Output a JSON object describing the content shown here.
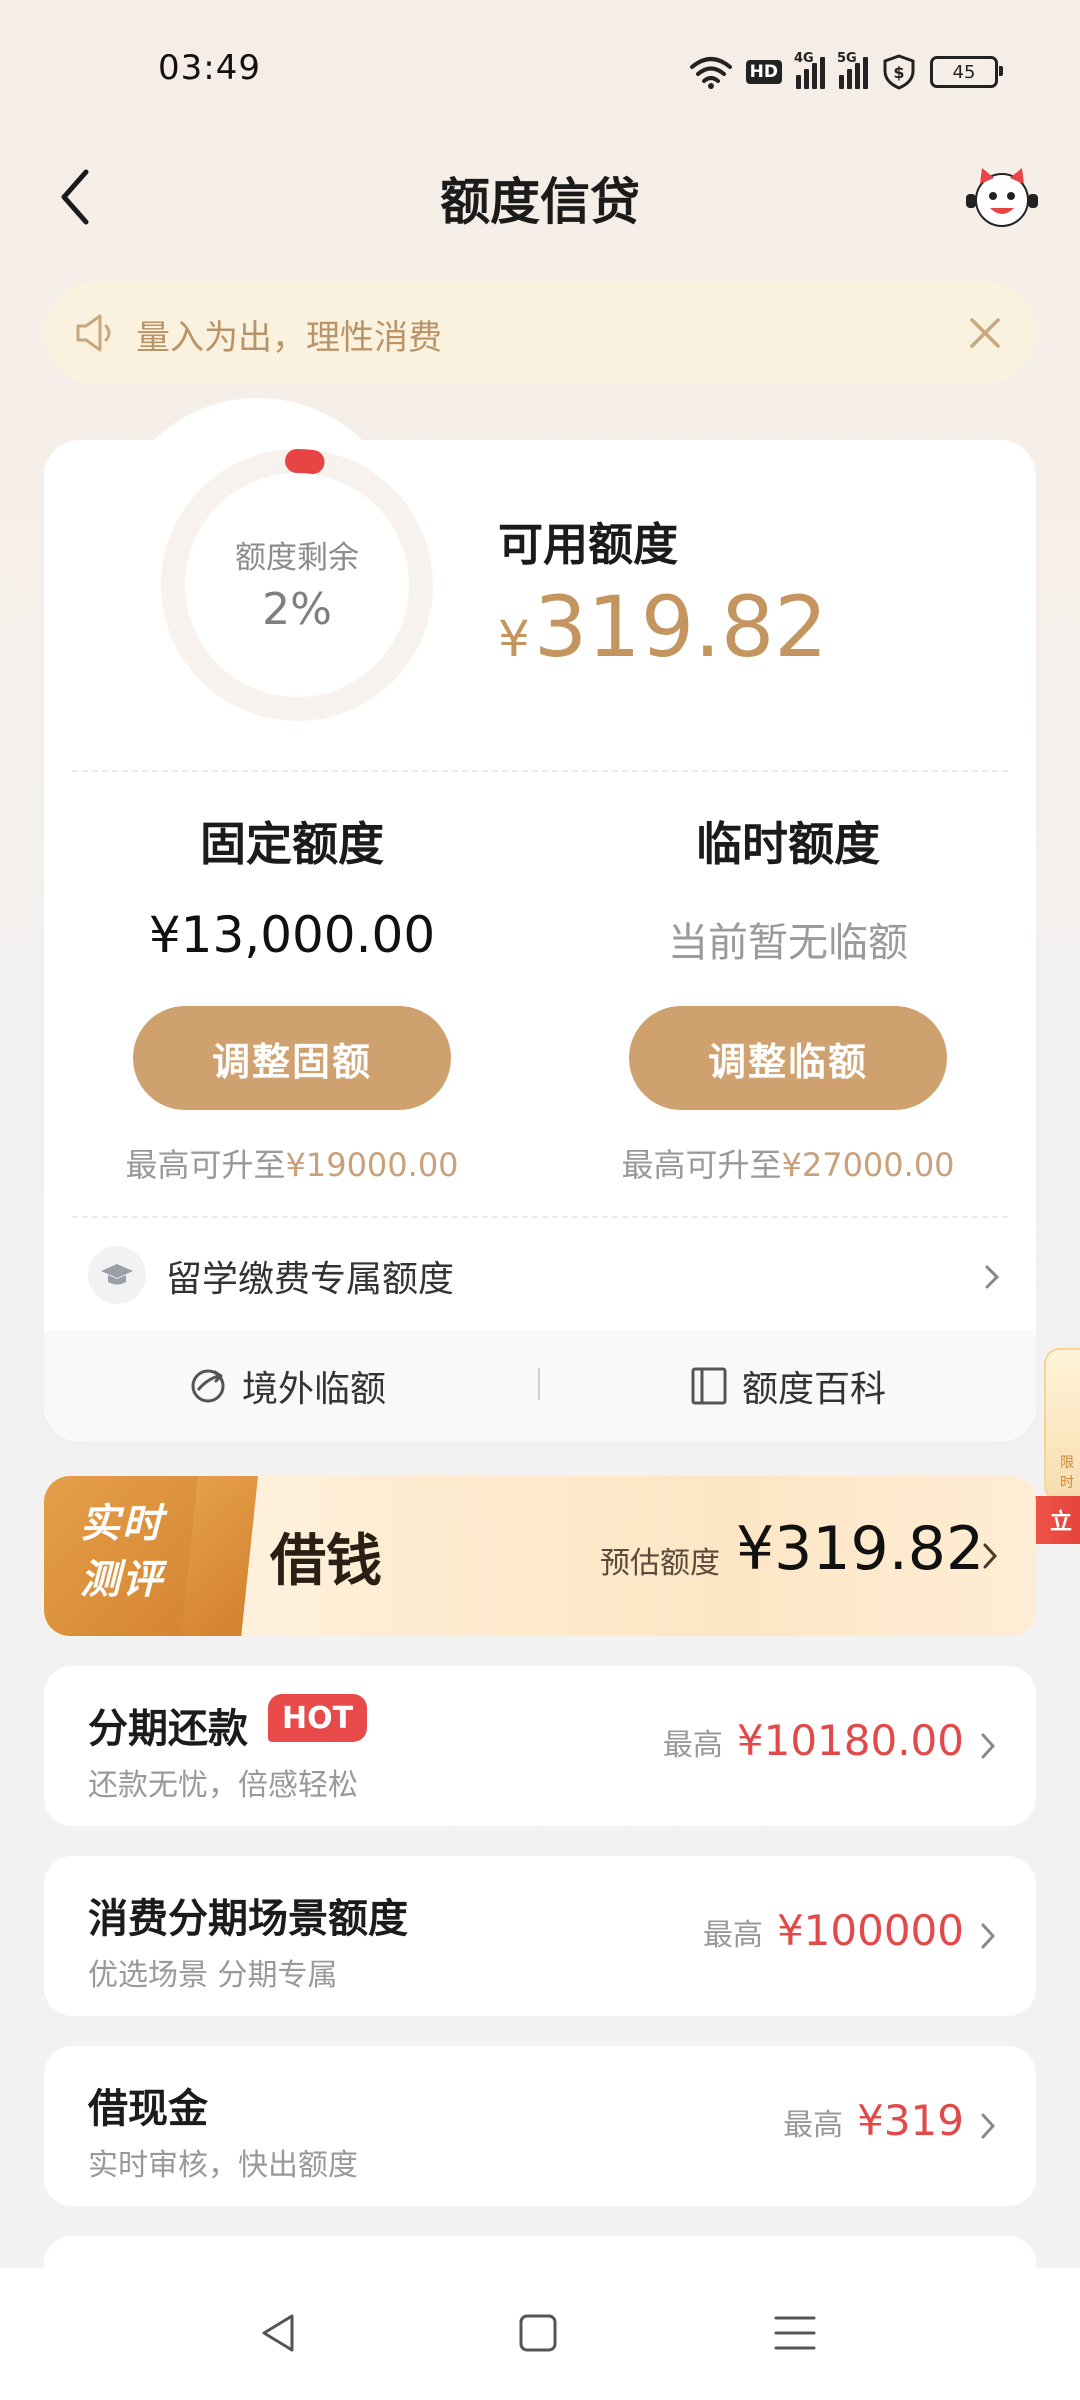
{
  "status_bar": {
    "time": "03:49",
    "battery": "45",
    "hd_label": "HD",
    "net1": "4G",
    "net2": "5G",
    "icons": [
      "wifi-icon",
      "hd-icon",
      "signal-4g-icon",
      "signal-5g-icon",
      "shield-dollar-icon",
      "battery-icon"
    ]
  },
  "header": {
    "title": "额度信贷",
    "back_icon": "chevron-left-icon",
    "mascot_icon": "mascot-icon"
  },
  "notice": {
    "text": "量入为出，理性消费",
    "icon": "speaker-icon",
    "close_icon": "close-icon"
  },
  "credit": {
    "ring_label": "额度剩余",
    "ring_value": "2%",
    "ring_fraction": 0.02,
    "available_label": "可用额度",
    "currency": "¥",
    "available_amount": "319.82",
    "fixed": {
      "title": "固定额度",
      "amount": "¥13,000.00",
      "button": "调整固额",
      "max_prefix": "最高可升至",
      "max_value": "¥19000.00"
    },
    "temp": {
      "title": "临时额度",
      "status": "当前暂无临额",
      "button": "调整临额",
      "max_prefix": "最高可升至",
      "max_value": "¥27000.00"
    },
    "study_row": "留学缴费专属额度",
    "footer": {
      "left": "境外临额",
      "right": "额度百科"
    }
  },
  "side_float": {
    "text": "限时",
    "badge": "立"
  },
  "borrow": {
    "tag_line1": "实时",
    "tag_line2": "测评",
    "title": "借钱",
    "est_label": "预估额度",
    "est_value": "¥319.82"
  },
  "list": [
    {
      "title": "分期还款",
      "badge": "HOT",
      "sub": "还款无忧，倍感轻松",
      "prefix": "最高",
      "amount": "¥10180.00"
    },
    {
      "title": "消费分期场景额度",
      "sub": "优选场景 分期专属",
      "prefix": "最高",
      "amount": "¥100000"
    },
    {
      "title": "借现金",
      "sub": "实时审核，快出额度",
      "prefix": "最高",
      "amount": "¥319"
    }
  ],
  "colors": {
    "accent_gold": "#c4955f",
    "button_gold": "#cfa16f",
    "amount_red": "#e24a4a",
    "ring_red": "#e84444"
  }
}
